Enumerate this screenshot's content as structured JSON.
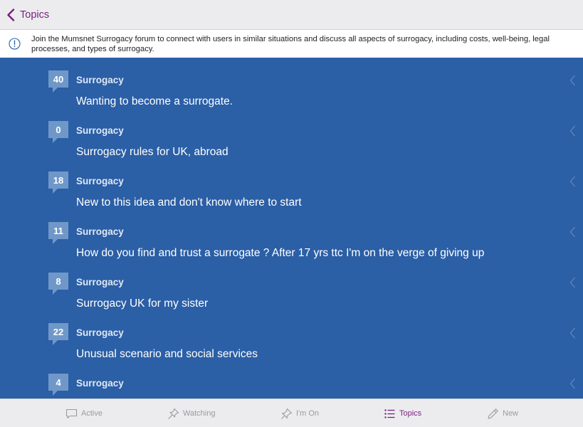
{
  "nav": {
    "back_label": "Topics"
  },
  "banner": {
    "text": "Join the Mumsnet Surrogacy forum to connect with users in similar situations and discuss all aspects of surrogacy, including costs, well-being, legal processes, and types of surrogacy."
  },
  "topics": [
    {
      "count": "40",
      "forum": "Surrogacy",
      "title": "Wanting to become a surrogate."
    },
    {
      "count": "0",
      "forum": "Surrogacy",
      "title": "Surrogacy rules for UK, abroad"
    },
    {
      "count": "18",
      "forum": "Surrogacy",
      "title": "New to this idea and don't know where to start"
    },
    {
      "count": "11",
      "forum": "Surrogacy",
      "title": "How do you find and trust a surrogate ? After 17 yrs ttc I'm on the verge of giving up"
    },
    {
      "count": "8",
      "forum": "Surrogacy",
      "title": "Surrogacy UK for my sister"
    },
    {
      "count": "22",
      "forum": "Surrogacy",
      "title": "Unusual scenario and social services"
    },
    {
      "count": "4",
      "forum": "Surrogacy",
      "title": ""
    }
  ],
  "tabs": [
    {
      "label": "Active",
      "icon": "speech-bubble-icon",
      "active": false
    },
    {
      "label": "Watching",
      "icon": "pin-icon",
      "active": false
    },
    {
      "label": "I'm On",
      "icon": "pushpin-icon",
      "active": false
    },
    {
      "label": "Topics",
      "icon": "list-icon",
      "active": true
    },
    {
      "label": "New",
      "icon": "pencil-icon",
      "active": false
    }
  ],
  "colors": {
    "accent": "#7a1f7e",
    "list_background": "#2b5fa6",
    "badge": "#6f98c9",
    "bar_background": "#ececee"
  }
}
